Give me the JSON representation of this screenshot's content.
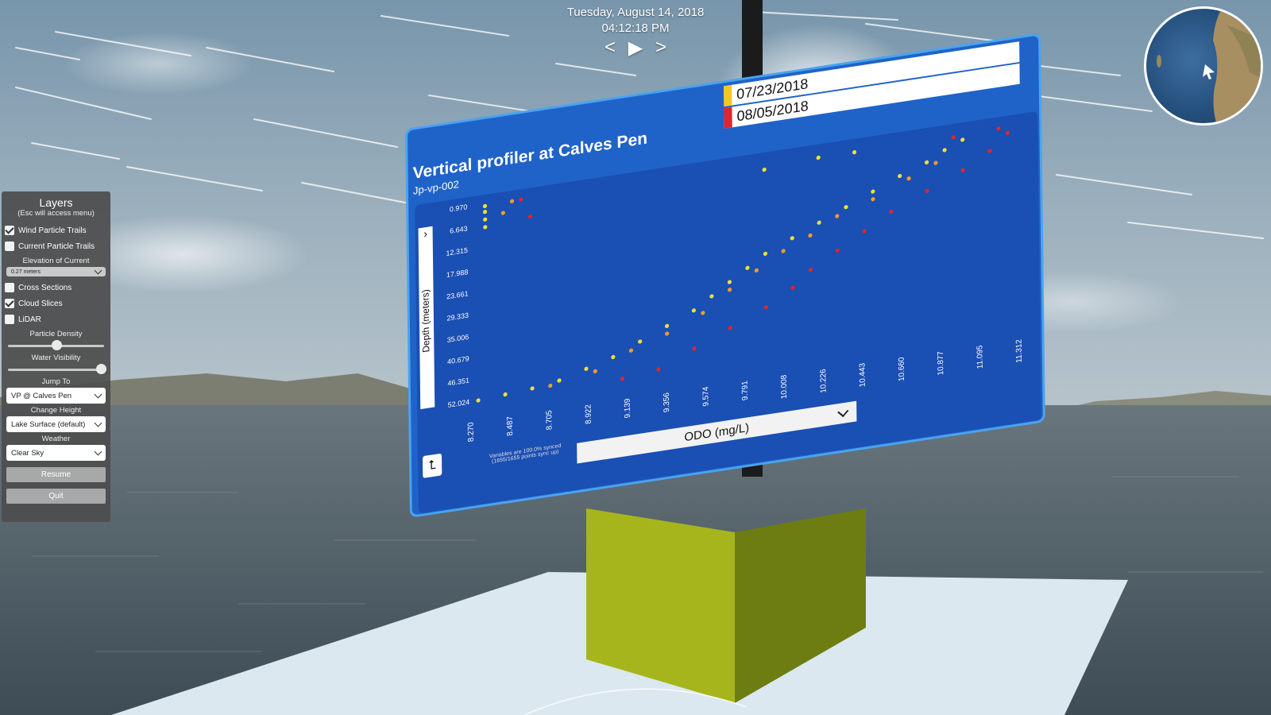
{
  "datetime": {
    "date": "Tuesday, August 14, 2018",
    "time": "04:12:18 PM"
  },
  "playback": {
    "prev": "<",
    "play": "▶",
    "next": ">"
  },
  "colors": {
    "sky": "#8aa4b8",
    "water": "#52626c",
    "board": "#1f63c9",
    "board_border": "#4aa3ef",
    "pad": "#dce8ef",
    "box_face": "#a6b51c",
    "box_side": "#6e7d12",
    "series_old": "#f2df38",
    "series_mid": "#f49a30",
    "series_new": "#e0262c"
  },
  "layers": {
    "title": "Layers",
    "subtitle": "(Esc will access menu)",
    "checks": [
      {
        "label": "Wind Particle Trails",
        "checked": true
      },
      {
        "label": "Current Particle Trails",
        "checked": false
      }
    ],
    "elevation_label": "Elevation of Current",
    "elevation_value": "0.27 meters",
    "checks2": [
      {
        "label": "Cross Sections",
        "checked": false
      },
      {
        "label": "Cloud Slices",
        "checked": true
      },
      {
        "label": "LiDAR",
        "checked": false
      }
    ],
    "particle_density_label": "Particle Density",
    "particle_density_level": 0.5,
    "water_visibility_label": "Water Visibility",
    "water_visibility_level": 0.97,
    "jump_to_label": "Jump To",
    "jump_to_value": "VP @ Calves Pen",
    "change_height_label": "Change Height",
    "change_height_value": "Lake Surface (default)",
    "weather_label": "Weather",
    "weather_value": "Clear Sky",
    "resume_label": "Resume",
    "quit_label": "Quit"
  },
  "board": {
    "title": "Vertical profiler at Calves Pen",
    "subtitle": "Jp-vp-002",
    "dates": [
      {
        "label": "07/23/2018",
        "color": "#f2c81e"
      },
      {
        "label": "08/05/2018",
        "color": "#e0262c"
      }
    ],
    "y_label": "Depth (meters)",
    "y_toggle": "›",
    "corner_icon": "⮤",
    "sync_note": "Variables are 100.0% synced (1655/1655 points sync up)",
    "variable": "ODO (mg/L)"
  },
  "chart_data": {
    "type": "scatter",
    "xlabel": "ODO (mg/L)",
    "ylabel": "Depth (meters)",
    "x_ticks": [
      "8.270",
      "8.487",
      "8.705",
      "8.922",
      "9.139",
      "9.356",
      "9.574",
      "9.791",
      "10.008",
      "10.226",
      "10.443",
      "10.660",
      "10.877",
      "11.095",
      "11.312"
    ],
    "y_ticks": [
      "0.970",
      "6.643",
      "12.315",
      "17.988",
      "23.661",
      "29.333",
      "35.006",
      "40.679",
      "46.351",
      "52.024"
    ],
    "xlim": [
      8.27,
      11.312
    ],
    "ylim": [
      0.97,
      52.024
    ],
    "y_inverted": true,
    "series": [
      {
        "color": "#f2df38",
        "points": [
          [
            8.3,
            52
          ],
          [
            8.45,
            51.5
          ],
          [
            8.6,
            51
          ],
          [
            8.75,
            50
          ],
          [
            8.9,
            48
          ],
          [
            9.05,
            46
          ],
          [
            9.2,
            43
          ],
          [
            9.35,
            40
          ],
          [
            9.5,
            37
          ],
          [
            9.6,
            34
          ],
          [
            9.7,
            31
          ],
          [
            9.8,
            28
          ],
          [
            9.9,
            25
          ],
          [
            10.05,
            22
          ],
          [
            10.2,
            19
          ],
          [
            10.35,
            16
          ],
          [
            10.5,
            13
          ],
          [
            10.65,
            10
          ],
          [
            10.8,
            7.5
          ],
          [
            10.9,
            5
          ],
          [
            11.0,
            3
          ],
          [
            8.35,
            1.5
          ],
          [
            8.35,
            3
          ],
          [
            8.35,
            5
          ],
          [
            8.35,
            7
          ],
          [
            10.4,
            2
          ],
          [
            10.2,
            2
          ],
          [
            9.9,
            3
          ]
        ]
      },
      {
        "color": "#f49a30",
        "points": [
          [
            8.7,
            51
          ],
          [
            8.95,
            49
          ],
          [
            9.15,
            45
          ],
          [
            9.35,
            42
          ],
          [
            9.55,
            38
          ],
          [
            9.7,
            33
          ],
          [
            9.85,
            29
          ],
          [
            10.0,
            25
          ],
          [
            10.15,
            22
          ],
          [
            10.3,
            18
          ],
          [
            10.5,
            15
          ],
          [
            10.7,
            11
          ],
          [
            10.85,
            8
          ],
          [
            8.5,
            1.3
          ],
          [
            8.45,
            4
          ]
        ]
      },
      {
        "color": "#e0262c",
        "points": [
          [
            9.1,
            52
          ],
          [
            9.3,
            51
          ],
          [
            9.5,
            47
          ],
          [
            9.7,
            43
          ],
          [
            9.9,
            39
          ],
          [
            10.05,
            35
          ],
          [
            10.15,
            31
          ],
          [
            10.3,
            27
          ],
          [
            10.45,
            23
          ],
          [
            10.6,
            19
          ],
          [
            10.8,
            15
          ],
          [
            11.0,
            11
          ],
          [
            11.15,
            7
          ],
          [
            11.25,
            3
          ],
          [
            8.55,
            1.2
          ],
          [
            8.6,
            6
          ],
          [
            10.95,
            2
          ],
          [
            11.2,
            1.5
          ]
        ]
      }
    ]
  }
}
